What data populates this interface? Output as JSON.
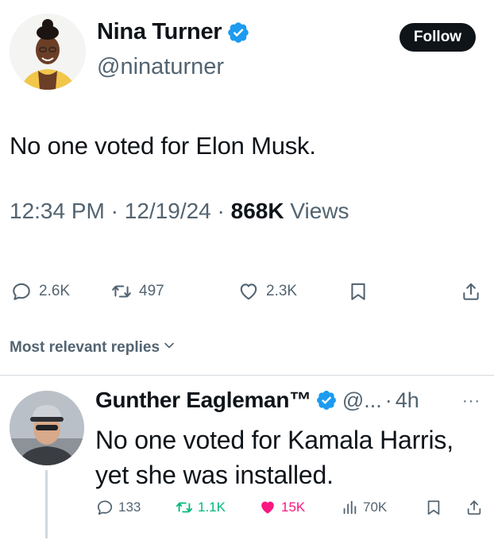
{
  "tweet": {
    "author_name": "Nina Turner",
    "author_handle": "@ninaturner",
    "follow_label": "Follow",
    "text": "No one voted for Elon Musk.",
    "time": "12:34 PM",
    "sep1": " · ",
    "date": "12/19/24",
    "sep2": " · ",
    "views_count": "868K",
    "views_label": " Views",
    "stats": {
      "replies": "2.6K",
      "reposts": "497",
      "likes": "2.3K"
    }
  },
  "replies_section": {
    "label": "Most relevant replies"
  },
  "reply": {
    "author_name": "Gunther Eagleman™",
    "author_handle": "@...",
    "dot": "·",
    "time": "4h",
    "more": "···",
    "text": "No one voted for Kamala Harris,  yet she was installed.",
    "stats": {
      "replies": "133",
      "reposts": "1.1K",
      "likes": "15K",
      "views": "70K"
    }
  },
  "colors": {
    "text_primary": "#0f1419",
    "text_secondary": "#536471",
    "verified_blue": "#1d9bf0",
    "repost_green": "#00ba7c",
    "like_pink": "#f91880"
  },
  "icons": {
    "verified": "verified-badge-icon",
    "reply": "speech-bubble-icon",
    "repost": "repost-arrows-icon",
    "like": "heart-icon",
    "bookmark": "bookmark-icon",
    "share": "share-upload-icon",
    "views": "bar-chart-icon",
    "chevron": "chevron-down-icon"
  }
}
